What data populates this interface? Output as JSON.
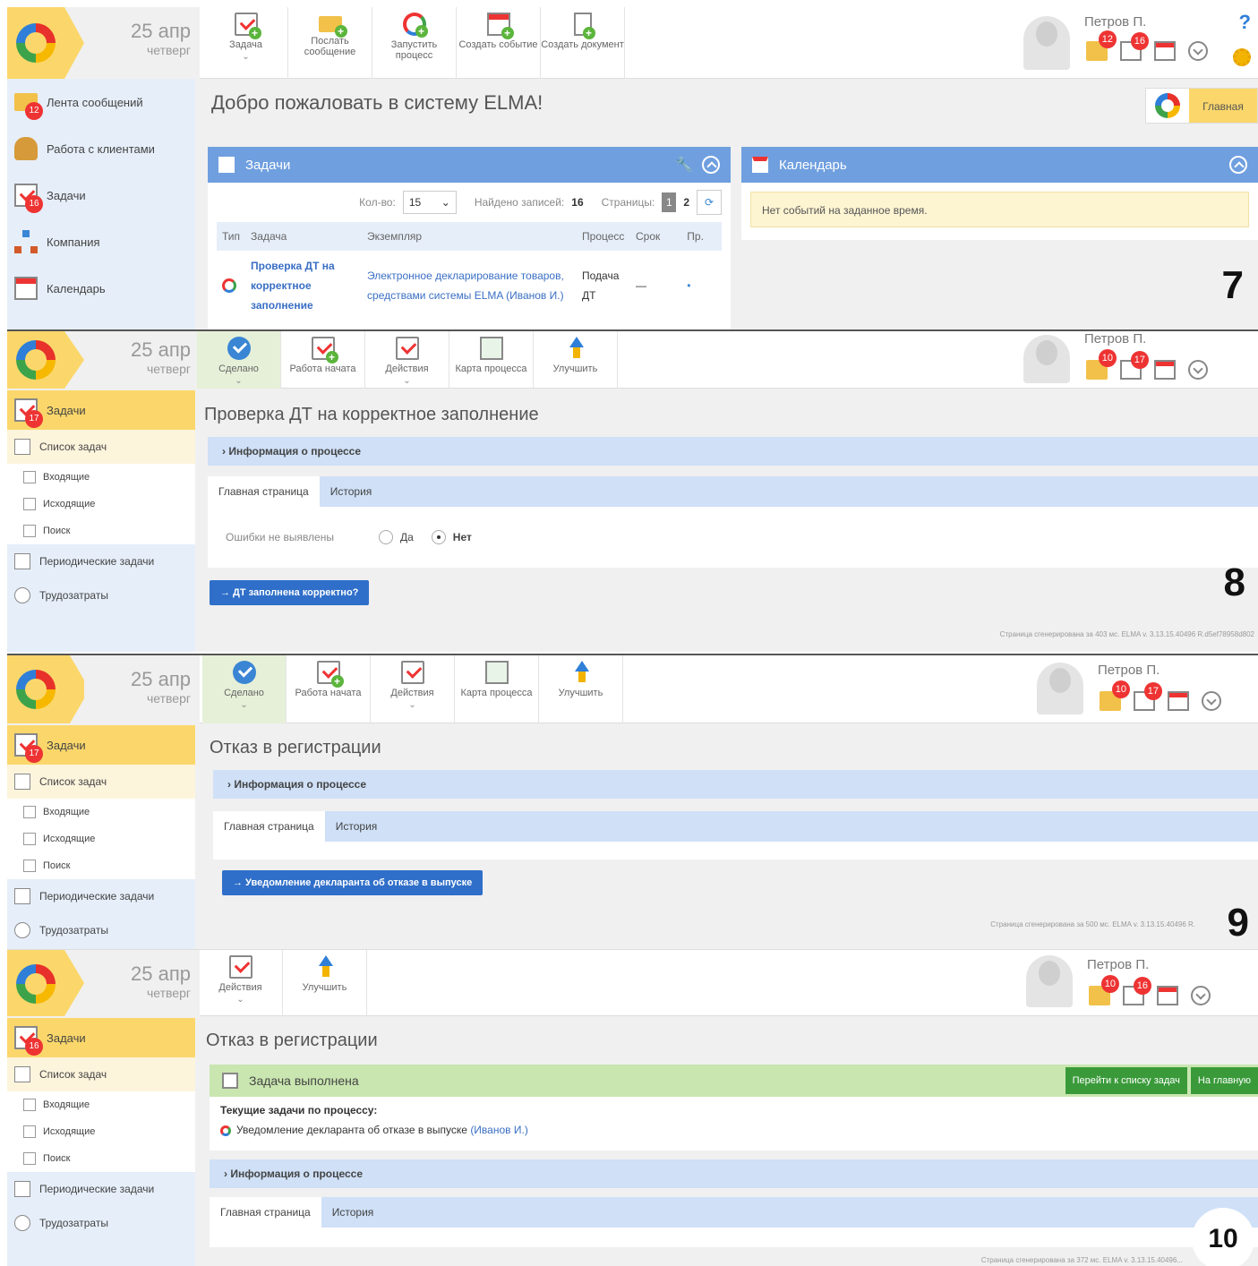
{
  "common": {
    "date_day": "25 апр",
    "date_weekday": "четверг",
    "user_name": "Петров П.",
    "colors": {
      "accent_blue": "#6f9fdf",
      "brand_yellow": "#fbd76b",
      "badge_red": "#e33333",
      "success_green": "#3a9a3a"
    }
  },
  "panel7": {
    "number": "7",
    "toolbar": [
      {
        "label": "Задача",
        "icon": "task-icon",
        "dropdown": true
      },
      {
        "label": "Послать сообщение",
        "icon": "mail-icon"
      },
      {
        "label": "Запустить процесс",
        "icon": "process-icon"
      },
      {
        "label": "Создать событие",
        "icon": "calendar-icon"
      },
      {
        "label": "Создать документ",
        "icon": "document-icon"
      }
    ],
    "badges": {
      "messages": "12",
      "tasks": "16"
    },
    "help": "?",
    "sidebar": [
      {
        "label": "Лента сообщений",
        "icon": "mail-icon",
        "badge": "12"
      },
      {
        "label": "Работа с клиентами",
        "icon": "person-icon"
      },
      {
        "label": "Задачи",
        "icon": "task-icon",
        "badge": "16"
      },
      {
        "label": "Компания",
        "icon": "org-icon"
      },
      {
        "label": "Календарь",
        "icon": "calendar-icon"
      }
    ],
    "title": "Добро пожаловать в систему ELMA!",
    "home_button": "Главная",
    "tasks_portlet": {
      "title": "Задачи",
      "count_label": "Кол-во:",
      "count_value": "15",
      "found_label": "Найдено записей:",
      "found_value": "16",
      "pages_label": "Страницы:",
      "page_current": "1",
      "page_next": "2",
      "columns": [
        "Тип",
        "Задача",
        "Экземпляр",
        "Процесс",
        "Срок",
        "Пр."
      ],
      "rows": [
        {
          "task": "Проверка ДТ на корректное заполнение",
          "instance": "Электронное декларирование товаров, средствами системы ELMA (Иванов И.)",
          "process": "Подача ДТ",
          "deadline": "—",
          "priority": "•"
        }
      ]
    },
    "calendar_portlet": {
      "title": "Календарь",
      "empty_note": "Нет событий на заданное время."
    }
  },
  "panel8": {
    "number": "8",
    "toolbar": [
      {
        "label": "Сделано",
        "icon": "check-icon",
        "dropdown": true
      },
      {
        "label": "Работа начата",
        "icon": "task-icon"
      },
      {
        "label": "Действия",
        "icon": "task-icon",
        "dropdown": true
      },
      {
        "label": "Карта процесса",
        "icon": "map-icon"
      },
      {
        "label": "Улучшить",
        "icon": "improve-icon"
      }
    ],
    "badges": {
      "messages": "10",
      "tasks": "17"
    },
    "sidebar": {
      "top": "Задачи",
      "top_badge": "17",
      "list": "Список задач",
      "subs": [
        "Входящие",
        "Исходящие",
        "Поиск"
      ],
      "periodic": "Периодические задачи",
      "labor": "Трудозатраты"
    },
    "title": "Проверка ДТ на корректное заполнение",
    "info_bar": "Информация о процессе",
    "tabs": [
      "Главная страница",
      "История"
    ],
    "field_label": "Ошибки не выявлены",
    "radio_yes": "Да",
    "radio_no": "Нет",
    "action_button": "→ ДТ заполнена корректно?",
    "footer": "Страница сгенерирована за 403 мс. ELMA v. 3.13.15.40496 R.d5ef78958d802"
  },
  "panel9": {
    "number": "9",
    "toolbar": [
      {
        "label": "Сделано",
        "icon": "check-icon",
        "dropdown": true
      },
      {
        "label": "Работа начата",
        "icon": "task-icon"
      },
      {
        "label": "Действия",
        "icon": "task-icon",
        "dropdown": true
      },
      {
        "label": "Карта процесса",
        "icon": "map-icon"
      },
      {
        "label": "Улучшить",
        "icon": "improve-icon"
      }
    ],
    "badges": {
      "messages": "10",
      "tasks": "17"
    },
    "sidebar": {
      "top": "Задачи",
      "top_badge": "17",
      "list": "Список задач",
      "subs": [
        "Входящие",
        "Исходящие",
        "Поиск"
      ],
      "periodic": "Периодические задачи",
      "labor": "Трудозатраты"
    },
    "title": "Отказ в регистрации",
    "info_bar": "Информация о процессе",
    "tabs": [
      "Главная страница",
      "История"
    ],
    "action_button": "→ Уведомление декларанта об отказе в выпуске",
    "footer": "Страница сгенерирована за 500 мс. ELMA v. 3.13.15.40496 R."
  },
  "panel10": {
    "number": "10",
    "toolbar": [
      {
        "label": "Действия",
        "icon": "task-icon",
        "dropdown": true
      },
      {
        "label": "Улучшить",
        "icon": "improve-icon"
      }
    ],
    "badges": {
      "messages": "10",
      "tasks": "16"
    },
    "sidebar": {
      "top": "Задачи",
      "top_badge": "16",
      "list": "Список задач",
      "subs": [
        "Входящие",
        "Исходящие",
        "Поиск"
      ],
      "periodic": "Периодические задачи",
      "labor": "Трудозатраты"
    },
    "title": "Отказ в регистрации",
    "done_bar": "Задача выполнена",
    "btn_list": "Перейти к списку задач",
    "btn_home": "На главную",
    "current_label": "Текущие задачи по процессу:",
    "current_task": "Уведомление декларанта об отказе в выпуске",
    "current_task_user": "(Иванов И.)",
    "info_bar": "Информация о процессе",
    "tabs": [
      "Главная страница",
      "История"
    ],
    "footer": "Страница сгенерирована за 372 мс. ELMA v. 3.13.15.40496..."
  }
}
